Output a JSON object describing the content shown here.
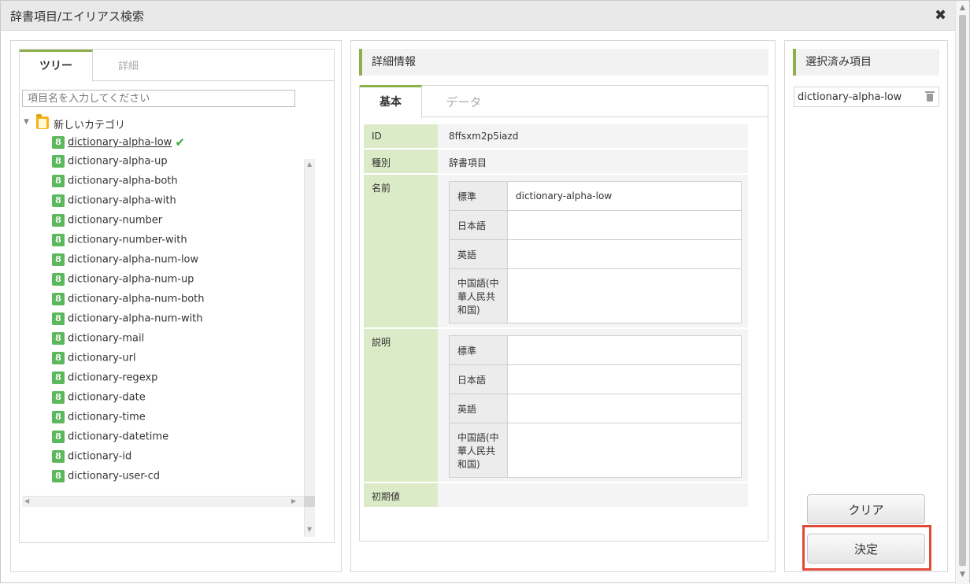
{
  "window": {
    "title": "辞書項目/エイリアス検索",
    "close_icon": "✖"
  },
  "left": {
    "tabs": [
      {
        "label": "ツリー"
      },
      {
        "label": "詳細"
      }
    ],
    "search_placeholder": "項目名を入力してください",
    "root": {
      "label": "新しいカテゴリ"
    },
    "item_icon_glyph": "8",
    "items": [
      {
        "label": "dictionary-alpha-low"
      },
      {
        "label": "dictionary-alpha-up"
      },
      {
        "label": "dictionary-alpha-both"
      },
      {
        "label": "dictionary-alpha-with"
      },
      {
        "label": "dictionary-number"
      },
      {
        "label": "dictionary-number-with"
      },
      {
        "label": "dictionary-alpha-num-low"
      },
      {
        "label": "dictionary-alpha-num-up"
      },
      {
        "label": "dictionary-alpha-num-both"
      },
      {
        "label": "dictionary-alpha-num-with"
      },
      {
        "label": "dictionary-mail"
      },
      {
        "label": "dictionary-url"
      },
      {
        "label": "dictionary-regexp"
      },
      {
        "label": "dictionary-date"
      },
      {
        "label": "dictionary-time"
      },
      {
        "label": "dictionary-datetime"
      },
      {
        "label": "dictionary-id"
      },
      {
        "label": "dictionary-user-cd"
      }
    ],
    "check_glyph": "✔"
  },
  "middle": {
    "header": "詳細情報",
    "tabs": [
      {
        "label": "基本"
      },
      {
        "label": "データ"
      }
    ],
    "fields": {
      "id": {
        "label": "ID",
        "value": "8ffsxm2p5iazd"
      },
      "kind": {
        "label": "種別",
        "value": "辞書項目"
      },
      "name": {
        "label": "名前",
        "rows": [
          {
            "lang": "標準",
            "value": "dictionary-alpha-low"
          },
          {
            "lang": "日本語",
            "value": ""
          },
          {
            "lang": "英語",
            "value": ""
          },
          {
            "lang": "中国語(中華人民共和国)",
            "value": ""
          }
        ]
      },
      "description": {
        "label": "説明",
        "rows": [
          {
            "lang": "標準",
            "value": ""
          },
          {
            "lang": "日本語",
            "value": ""
          },
          {
            "lang": "英語",
            "value": ""
          },
          {
            "lang": "中国語(中華人民共和国)",
            "value": ""
          }
        ]
      },
      "initial": {
        "label": "初期値",
        "value": ""
      }
    }
  },
  "right": {
    "header": "選択済み項目",
    "selected": [
      {
        "label": "dictionary-alpha-low"
      }
    ],
    "clear_label": "クリア",
    "ok_label": "決定"
  },
  "colors": {
    "accent": "#8db04a",
    "label_bg": "#dcebc7",
    "highlight": "#e0483a",
    "dict_icon": "#5cb85c"
  }
}
